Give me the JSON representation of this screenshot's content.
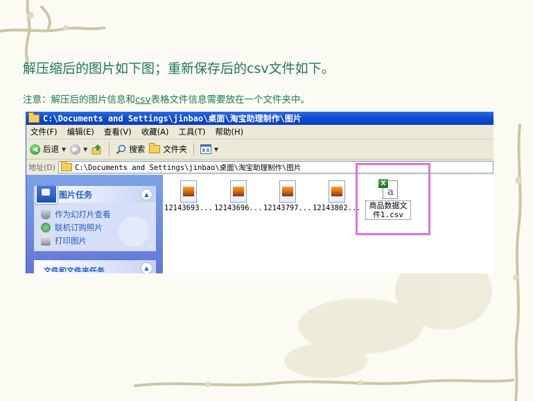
{
  "slide": {
    "title": "解压缩后的图片如下图；重新保存后的csv文件如下。",
    "note_prefix": "注意：解压后的图片信息和",
    "note_underlined": "csv",
    "note_suffix": "表格文件信息需要放在一个文件夹中。"
  },
  "window": {
    "title": "C:\\Documents and Settings\\jinbao\\桌面\\淘宝助理制作\\图片",
    "menu": [
      "文件(F)",
      "编辑(E)",
      "查看(V)",
      "收藏(A)",
      "工具(T)",
      "帮助(H)"
    ],
    "toolbar": {
      "back": "后退",
      "search": "搜索",
      "folders": "文件夹"
    },
    "address_label": "地址(D)",
    "address_value": "C:\\Documents and Settings\\jinbao\\桌面\\淘宝助理制作\\图片"
  },
  "task_pane": {
    "panel_title": "图片任务",
    "tasks": [
      "作为幻灯片查看",
      "联机订购照片",
      "打印图片"
    ],
    "panel2_title": "文件和文件夹任务"
  },
  "files": [
    {
      "name": "12143693..."
    },
    {
      "name": "12143696..."
    },
    {
      "name": "12143797..."
    },
    {
      "name": "12143802..."
    }
  ],
  "csv_file": {
    "line1": "商品数据文",
    "line2": "件1.csv"
  },
  "colors": {
    "title_text": "#1d7a56",
    "highlight": "#e070e0",
    "xp_blue": "#0a48d0"
  }
}
